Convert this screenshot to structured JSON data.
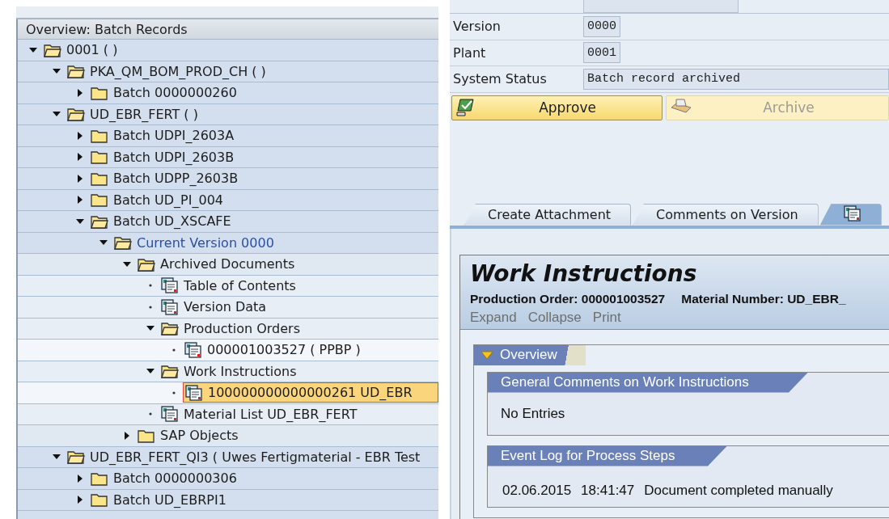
{
  "tree": {
    "title": "Overview: Batch Records",
    "nodes": [
      {
        "label": "0001 (  )",
        "kind": "folder",
        "expanded": true,
        "selected": false,
        "children": [
          {
            "label": "PKA_QM_BOM_PROD_CH (  )",
            "kind": "folder",
            "expanded": true,
            "selected": false,
            "children": [
              {
                "label": "Batch 0000000260",
                "kind": "folder",
                "expanded": false,
                "selected": false
              }
            ]
          },
          {
            "label": "UD_EBR_FERT (  )",
            "kind": "folder",
            "expanded": true,
            "selected": false,
            "children": [
              {
                "label": "Batch UDPI_2603A",
                "kind": "folder",
                "expanded": false,
                "selected": false
              },
              {
                "label": "Batch UDPI_2603B",
                "kind": "folder",
                "expanded": false,
                "selected": false
              },
              {
                "label": "Batch UDPP_2603B",
                "kind": "folder",
                "expanded": false,
                "selected": false
              },
              {
                "label": "Batch UD_PI_004",
                "kind": "folder",
                "expanded": false,
                "selected": false
              },
              {
                "label": "Batch UD_XSCAFE",
                "kind": "folder",
                "expanded": true,
                "selected": false,
                "children": [
                  {
                    "label": "Current Version 0000",
                    "kind": "version",
                    "expanded": true,
                    "selected": false,
                    "children": [
                      {
                        "label": "Archived Documents",
                        "kind": "folder",
                        "expanded": true,
                        "selected": false,
                        "children": [
                          {
                            "label": "Table of Contents",
                            "kind": "document",
                            "selected": false
                          },
                          {
                            "label": "Version Data",
                            "kind": "document",
                            "selected": false
                          },
                          {
                            "label": "Production Orders",
                            "kind": "folder",
                            "expanded": true,
                            "selected": false,
                            "children": [
                              {
                                "label": "000001003527 ( PPBP )",
                                "kind": "document",
                                "selected": false
                              }
                            ]
                          },
                          {
                            "label": "Work Instructions",
                            "kind": "folder",
                            "expanded": true,
                            "selected": false,
                            "children": [
                              {
                                "label": "100000000000000261 UD_EBR",
                                "kind": "document",
                                "selected": true
                              }
                            ]
                          },
                          {
                            "label": "Material List UD_EBR_FERT",
                            "kind": "document",
                            "selected": false
                          }
                        ]
                      },
                      {
                        "label": "SAP Objects",
                        "kind": "folder",
                        "expanded": false,
                        "selected": false
                      }
                    ]
                  }
                ]
              }
            ]
          },
          {
            "label": "UD_EBR_FERT_QI3 ( Uwes Fertigmaterial - EBR Test",
            "kind": "folder",
            "expanded": true,
            "selected": false,
            "children": [
              {
                "label": "Batch 0000000306",
                "kind": "folder",
                "expanded": false,
                "selected": false
              },
              {
                "label": "Batch UD_EBRPI1",
                "kind": "folder",
                "expanded": false,
                "selected": false
              }
            ]
          }
        ]
      }
    ]
  },
  "header_fields": [
    {
      "label": "Version",
      "value": "0000",
      "kind": "short"
    },
    {
      "label": "Plant",
      "value": "0001",
      "kind": "short"
    },
    {
      "label": "System Status",
      "value": "Batch record archived",
      "kind": "long"
    }
  ],
  "actions": [
    {
      "label": "Approve",
      "kind": "approve",
      "disabled": false
    },
    {
      "label": "Archive",
      "kind": "archive",
      "disabled": true
    }
  ],
  "tabs": [
    {
      "kind": "text",
      "label": "Create Attachment",
      "selected": false
    },
    {
      "kind": "text",
      "label": "Comments on Version",
      "selected": false
    },
    {
      "kind": "icon",
      "selected": true
    }
  ],
  "document": {
    "title": "Work Instructions",
    "production_order": "Production Order: 000001003527",
    "material_number": "Material Number: UD_EBR_",
    "links": [
      "Expand",
      "Collapse",
      "Print"
    ],
    "section": {
      "title": "Overview",
      "expanded": true,
      "subsections": [
        {
          "title": "General Comments on Work Instructions",
          "kind": "text",
          "text": "No Entries"
        },
        {
          "title": "Event Log for Process Steps",
          "kind": "log",
          "entries": [
            {
              "date": "02.06.2015",
              "time": "18:41:47",
              "text": "Document completed manually"
            }
          ]
        }
      ]
    }
  }
}
